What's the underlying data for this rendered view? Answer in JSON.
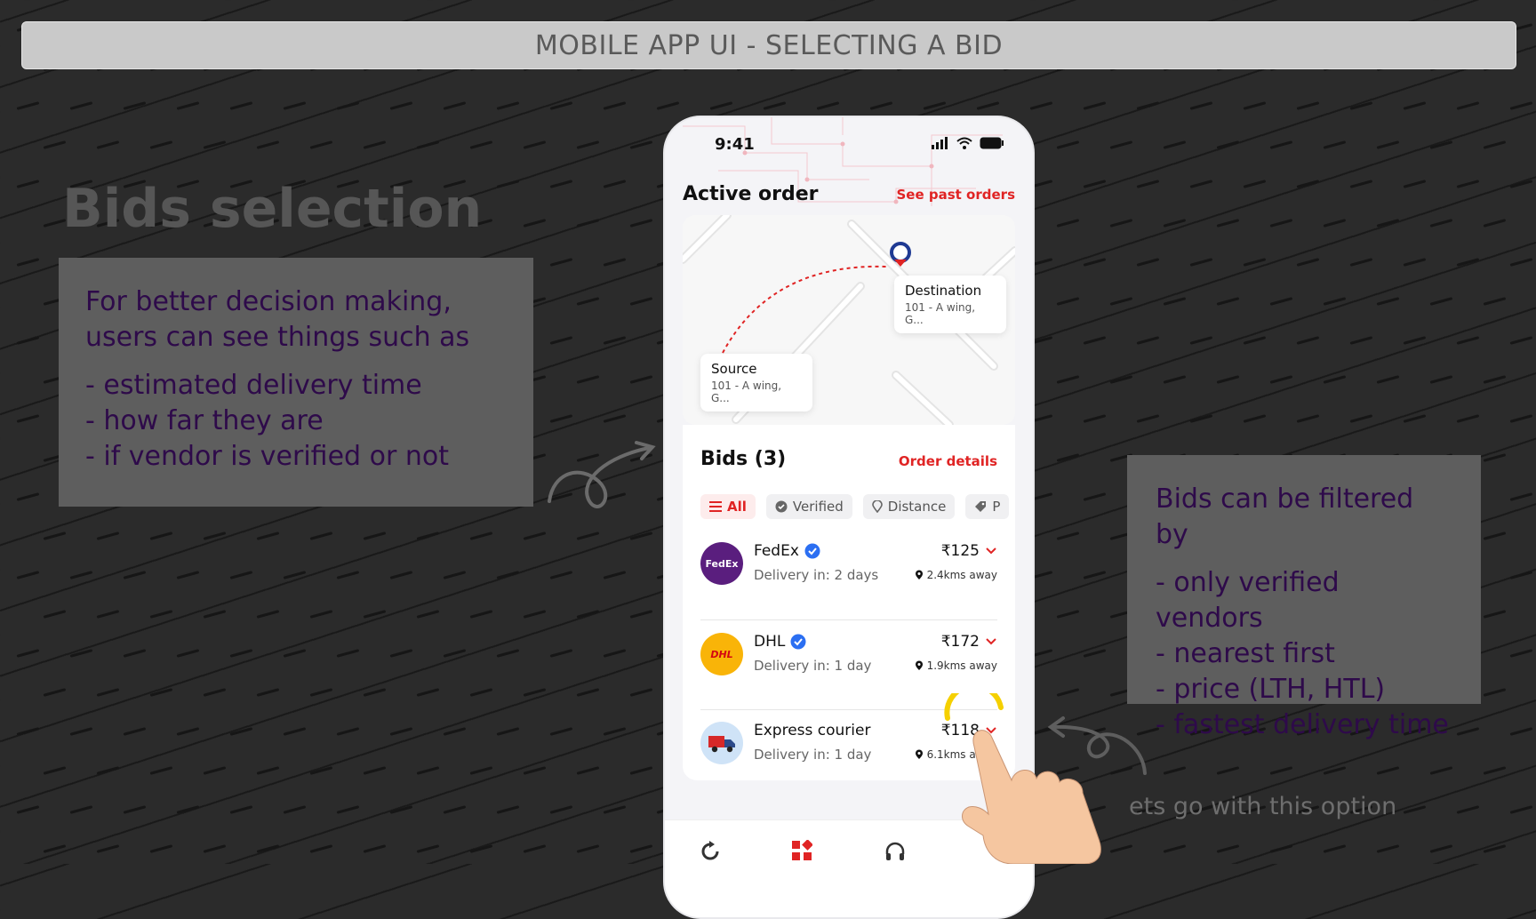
{
  "banner": {
    "title": "MOBILE APP UI - SELECTING A BID"
  },
  "left_panel": {
    "heading": "Bids selection",
    "intro": "For better decision making, users can see things such as",
    "points": [
      "- estimated delivery time",
      "- how far they are",
      "- if vendor is verified or not"
    ]
  },
  "right_panel": {
    "intro": "Bids can be filtered by",
    "points": [
      "- only verified vendors",
      "- nearest first",
      "- price  (LTH, HTL)",
      "- fastest delivery time"
    ]
  },
  "caption": "ets go with this option",
  "phone": {
    "status": {
      "time": "9:41"
    },
    "header": {
      "title": "Active order",
      "link": "See past orders"
    },
    "map": {
      "source": {
        "title": "Source",
        "address": "101 - A wing, G..."
      },
      "destination": {
        "title": "Destination",
        "address": "101 - A wing, G..."
      }
    },
    "bids": {
      "title": "Bids (3)",
      "link": "Order details",
      "filters": [
        "All",
        "Verified",
        "Distance",
        "P"
      ],
      "items": [
        {
          "name": "FedEx",
          "verified": true,
          "delivery": "Delivery in: 2 days",
          "price": "₹125",
          "distance": "2.4kms away",
          "logo_text": "FedEx",
          "logo_bg": "#5a1e7e",
          "logo_color": "#ffffff"
        },
        {
          "name": "DHL",
          "verified": true,
          "delivery": "Delivery in: 1 day",
          "price": "₹172",
          "distance": "1.9kms away",
          "logo_text": "DHL",
          "logo_bg": "#f9b408",
          "logo_color": "#d40511"
        },
        {
          "name": "Express courier",
          "verified": false,
          "delivery": "Delivery in: 1 day",
          "price": "₹118",
          "distance": "6.1kms away",
          "logo_text": "",
          "logo_bg": "#cfe3f7",
          "logo_color": "#d62828"
        }
      ]
    }
  },
  "colors": {
    "accent": "#e02424",
    "verified": "#2b6ff2",
    "note_bg": "#5e5e5e",
    "note_text": "#2e0a4a"
  }
}
